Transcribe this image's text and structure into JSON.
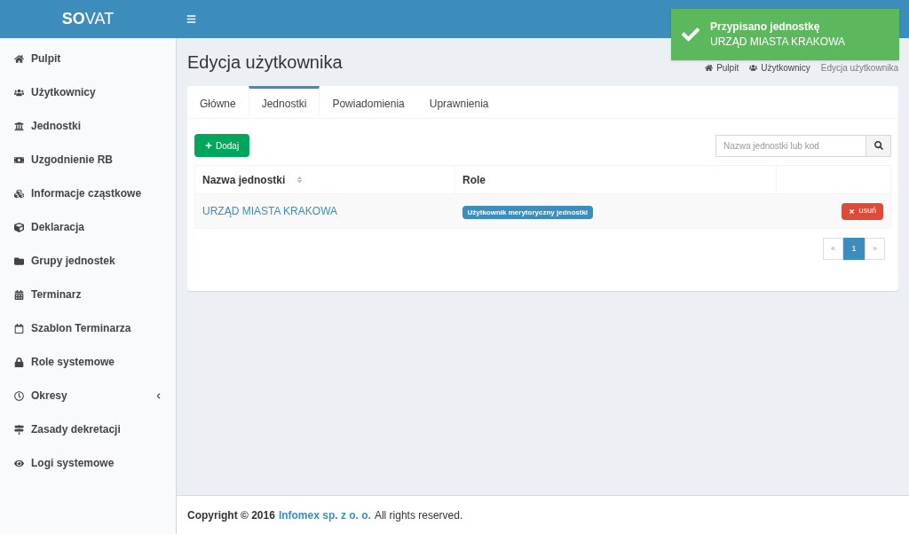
{
  "header": {
    "logo": "**SO**VAT"
  },
  "sidebar": {
    "items": [
      {
        "label": "Pulpit",
        "kind": "link"
      },
      {
        "label": "Użytkownicy",
        "kind": "link"
      },
      {
        "label": "Jednostki",
        "kind": "link"
      },
      {
        "label": "Uzgodnienie RB",
        "kind": "link"
      },
      {
        "label": "Informacje cząstkowe",
        "kind": "link"
      },
      {
        "label": "Deklaracja",
        "kind": "link"
      },
      {
        "label": "Grupy jednostek",
        "kind": "link"
      },
      {
        "label": "Terminarz",
        "kind": "link"
      },
      {
        "label": "Szablon Terminarza",
        "kind": "link"
      },
      {
        "label": "Role systemowe",
        "kind": "link"
      },
      {
        "label": "Okresy",
        "kind": "submenu"
      },
      {
        "label": "Zasady dekretacji",
        "kind": "link"
      },
      {
        "label": "Logi systemowe",
        "kind": "link"
      }
    ]
  },
  "page_title": "Edycja użytkownika",
  "breadcrumb": [
    "Pulpit",
    "Użytkownicy",
    "Edycja użytkownika"
  ],
  "tabs": [
    {
      "label": "Główne",
      "selected": false
    },
    {
      "label": "Jednostki",
      "selected": true
    },
    {
      "label": "Powiadomienia",
      "selected": false
    },
    {
      "label": "Uprawnienia",
      "selected": false
    }
  ],
  "add_button": "Dodaj",
  "search": {
    "placeholder": "Nazwa jednostki lub kod"
  },
  "table": {
    "columns": [
      "Nazwa jednostki",
      "Role"
    ],
    "rows": [
      {
        "name": "URZĄD MIASTA KRAKOWA",
        "role": "Użytkownik merytoryczny jednostki",
        "action": "usuń"
      }
    ]
  },
  "pagination": {
    "prev": "«",
    "pages": [
      {
        "label": "1",
        "selected": true
      }
    ],
    "next": "»"
  },
  "toast": {
    "title": "Przypisano jednostkę",
    "message": "URZĄD MIASTA KRAKOWA"
  },
  "footer": {
    "prefix": "Copyright © 2016",
    "link": "Infomex sp. z o. o.",
    "suffix": "All rights reserved."
  }
}
